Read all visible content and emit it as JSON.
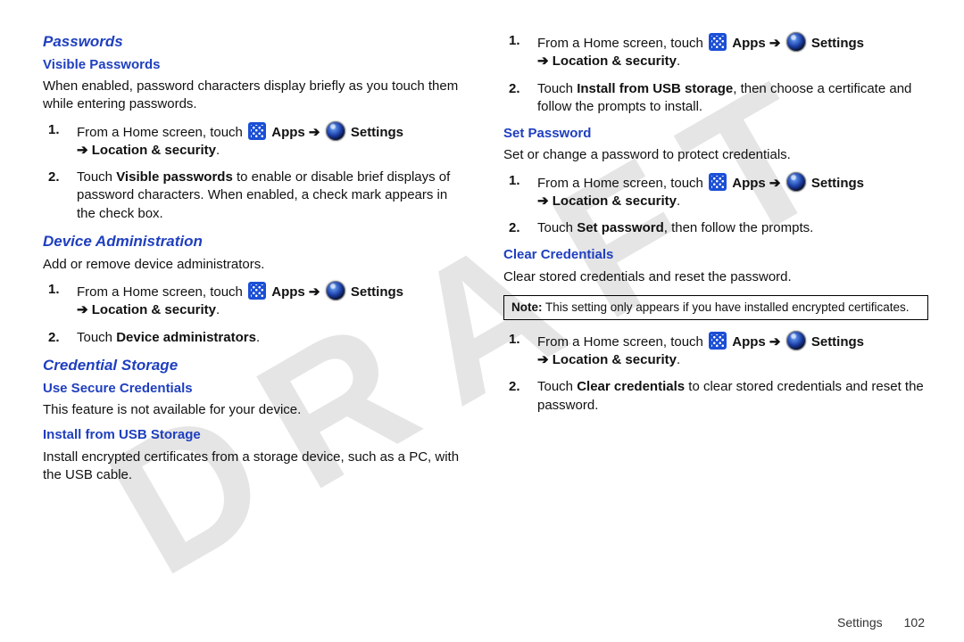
{
  "watermark": "DRAFT",
  "footer": {
    "section": "Settings",
    "page": "102"
  },
  "nav": {
    "from_home_prefix": "From a Home screen, touch ",
    "apps_label": "Apps",
    "settings_label": "Settings",
    "arrow": "➔",
    "loc_sec_prefix": "➔ ",
    "loc_sec": "Location & security",
    "period": "."
  },
  "left": {
    "passwords_h": "Passwords",
    "visible_pw_h": "Visible Passwords",
    "visible_pw_intro": "When enabled, password characters display briefly as you touch them while entering passwords.",
    "visible_pw_step2_a": "Touch ",
    "visible_pw_step2_b": "Visible passwords",
    "visible_pw_step2_c": " to enable or disable brief displays of password characters. When enabled, a check mark appears in the check box.",
    "device_admin_h": "Device Administration",
    "device_admin_intro": "Add or remove device administrators.",
    "device_admin_step2_a": "Touch ",
    "device_admin_step2_b": "Device administrators",
    "device_admin_step2_c": ".",
    "cred_storage_h": "Credential Storage",
    "use_secure_h": "Use Secure Credentials",
    "use_secure_text": "This feature is not available for your device.",
    "install_usb_h": "Install from USB Storage",
    "install_usb_text": "Install encrypted certificates from a storage device, such as a PC, with the USB cable."
  },
  "right": {
    "install_step2_a": "Touch ",
    "install_step2_b": "Install from USB storage",
    "install_step2_c": ", then choose a certificate and follow the prompts to install.",
    "set_pw_h": "Set Password",
    "set_pw_intro": "Set or change a password to protect credentials.",
    "set_pw_step2_a": "Touch ",
    "set_pw_step2_b": "Set password",
    "set_pw_step2_c": ", then follow the prompts.",
    "clear_cred_h": "Clear Credentials",
    "clear_cred_intro": "Clear stored credentials and reset the password.",
    "note_bold": "Note:",
    "note_text": " This setting only appears if you have installed encrypted certificates.",
    "clear_step2_a": "Touch ",
    "clear_step2_b": "Clear credentials",
    "clear_step2_c": " to clear stored credentials and reset the password."
  }
}
